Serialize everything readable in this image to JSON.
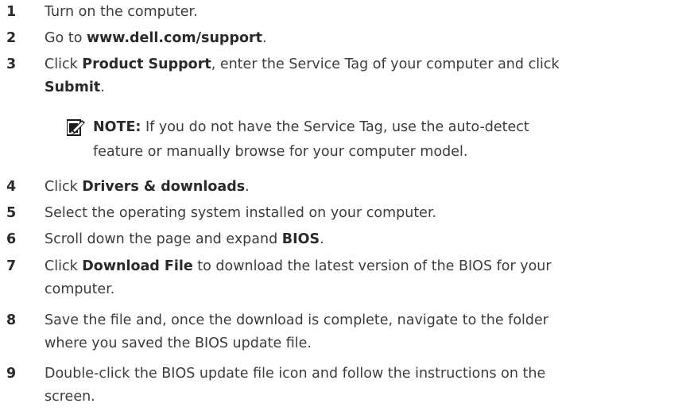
{
  "steps": [
    {
      "num": "1",
      "parts": [
        {
          "t": "Turn on the computer."
        }
      ]
    },
    {
      "num": "2",
      "parts": [
        {
          "t": "Go to "
        },
        {
          "t": "www.dell.com/support",
          "b": true
        },
        {
          "t": "."
        }
      ]
    },
    {
      "num": "3",
      "lines": [
        [
          {
            "t": "Click "
          },
          {
            "t": "Product Support",
            "b": true
          },
          {
            "t": ", enter the Service Tag of your computer and click"
          }
        ],
        [
          {
            "t": "Submit",
            "b": true
          },
          {
            "t": "."
          }
        ]
      ]
    },
    {
      "num": "4",
      "parts": [
        {
          "t": "Click "
        },
        {
          "t": "Drivers & downloads",
          "b": true
        },
        {
          "t": "."
        }
      ]
    },
    {
      "num": "5",
      "parts": [
        {
          "t": "Select the operating system installed on your computer."
        }
      ]
    },
    {
      "num": "6",
      "parts": [
        {
          "t": "Scroll down the page and expand "
        },
        {
          "t": "BIOS",
          "b": true
        },
        {
          "t": "."
        }
      ]
    },
    {
      "num": "7",
      "lines": [
        [
          {
            "t": "Click "
          },
          {
            "t": "Download File",
            "b": true
          },
          {
            "t": " to download the latest version of the BIOS for your"
          }
        ],
        [
          {
            "t": "computer."
          }
        ]
      ]
    },
    {
      "num": "8",
      "lines": [
        [
          {
            "t": "Save the file and, once the download is complete, navigate to the folder"
          }
        ],
        [
          {
            "t": "where you saved the BIOS update file."
          }
        ]
      ]
    },
    {
      "num": "9",
      "lines": [
        [
          {
            "t": "Double-click the BIOS update file icon and follow the instructions on the"
          }
        ],
        [
          {
            "t": "screen."
          }
        ]
      ]
    }
  ],
  "note": {
    "label": "NOTE:",
    "line1": " If you do not have the Service Tag, use the auto-detect",
    "line2": "feature or manually browse for your computer model.",
    "icon": "note-pencil-icon"
  }
}
